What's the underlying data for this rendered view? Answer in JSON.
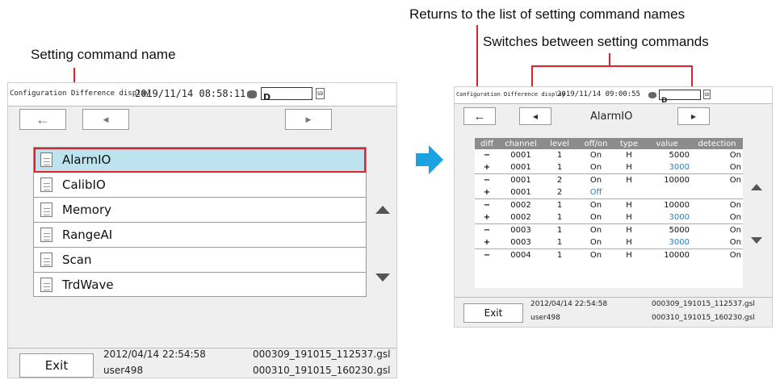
{
  "callouts": {
    "setting_name": "Setting command name",
    "returns": "Returns to the list of setting command names",
    "switches": "Switches between setting commands"
  },
  "left_screen": {
    "title": "Configuration Difference display",
    "datetime": "2019/11/14 08:58:11",
    "disk": "D",
    "sd": "SD",
    "items": [
      "AlarmIO",
      "CalibIO",
      "Memory",
      "RangeAI",
      "Scan",
      "TrdWave"
    ],
    "selected_index": 0,
    "exit_label": "Exit",
    "file_datetime": "2012/04/14 22:54:58",
    "user": "user498",
    "file1": "000309_191015_112537.gsl",
    "file2": "000310_191015_160230.gsl"
  },
  "right_screen": {
    "title": "Configuration Difference display",
    "datetime": "2019/11/14 09:00:55",
    "disk": "D",
    "sd": "SD",
    "command": "AlarmIO",
    "columns": [
      "diff",
      "channel",
      "level",
      "off/on",
      "type",
      "value",
      "detection"
    ],
    "rows": [
      {
        "diff": "−",
        "channel": "0001",
        "level": "1",
        "offon": "On",
        "type": "H",
        "value": "5000",
        "detection": "On",
        "value_changed": false,
        "offon_changed": false
      },
      {
        "diff": "+",
        "channel": "0001",
        "level": "1",
        "offon": "On",
        "type": "H",
        "value": "3000",
        "detection": "On",
        "value_changed": true,
        "offon_changed": false
      },
      {
        "diff": "−",
        "channel": "0001",
        "level": "2",
        "offon": "On",
        "type": "H",
        "value": "10000",
        "detection": "On",
        "value_changed": false,
        "offon_changed": false
      },
      {
        "diff": "+",
        "channel": "0001",
        "level": "2",
        "offon": "Off",
        "type": "",
        "value": "",
        "detection": "",
        "value_changed": false,
        "offon_changed": true
      },
      {
        "diff": "−",
        "channel": "0002",
        "level": "1",
        "offon": "On",
        "type": "H",
        "value": "10000",
        "detection": "On",
        "value_changed": false,
        "offon_changed": false
      },
      {
        "diff": "+",
        "channel": "0002",
        "level": "1",
        "offon": "On",
        "type": "H",
        "value": "3000",
        "detection": "On",
        "value_changed": true,
        "offon_changed": false
      },
      {
        "diff": "−",
        "channel": "0003",
        "level": "1",
        "offon": "On",
        "type": "H",
        "value": "5000",
        "detection": "On",
        "value_changed": false,
        "offon_changed": false
      },
      {
        "diff": "+",
        "channel": "0003",
        "level": "1",
        "offon": "On",
        "type": "H",
        "value": "3000",
        "detection": "On",
        "value_changed": true,
        "offon_changed": false
      },
      {
        "diff": "−",
        "channel": "0004",
        "level": "1",
        "offon": "On",
        "type": "H",
        "value": "10000",
        "detection": "On",
        "value_changed": false,
        "offon_changed": false
      }
    ],
    "exit_label": "Exit",
    "file_datetime": "2012/04/14 22:54:58",
    "user": "user498",
    "file1": "000309_191015_112537.gsl",
    "file2": "000310_191015_160230.gsl"
  },
  "colors": {
    "highlight": "#e0202a",
    "selection": "#bde3ef",
    "changed_value": "#2a7fc1",
    "arrow": "#1aa3e0",
    "header": "#8c8c8c"
  }
}
